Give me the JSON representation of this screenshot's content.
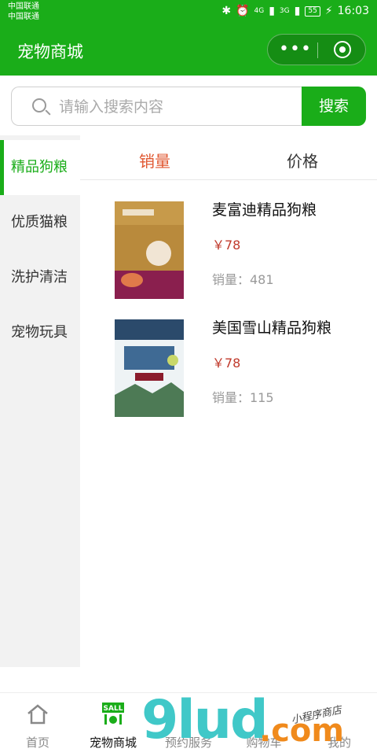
{
  "status_bar": {
    "carrier_1": "中国联通",
    "carrier_2": "中国联通",
    "signal_1": "4G",
    "signal_2": "3G",
    "battery": "55",
    "time": "16:03"
  },
  "nav": {
    "title": "宠物商城",
    "more": "•••"
  },
  "search": {
    "placeholder": "请输入搜索内容",
    "button": "搜索"
  },
  "sidebar": {
    "items": [
      {
        "label": "精品狗粮",
        "active": true
      },
      {
        "label": "优质猫粮",
        "active": false
      },
      {
        "label": "洗护清洁",
        "active": false
      },
      {
        "label": "宠物玩具",
        "active": false
      }
    ]
  },
  "sort_tabs": [
    {
      "label": "销量",
      "active": true
    },
    {
      "label": "价格",
      "active": false
    }
  ],
  "products": [
    {
      "name": "麦富迪精品狗粮",
      "price": "￥78",
      "sales": "销量：481",
      "image_icon": "dog-food-bag-icon"
    },
    {
      "name": "美国雪山精品狗粮",
      "price": "￥78",
      "sales": "销量：115",
      "image_icon": "dog-food-bag-icon"
    }
  ],
  "tab_bar": [
    {
      "label": "首页",
      "icon": "home-icon",
      "active": false
    },
    {
      "label": "宠物商城",
      "icon": "pet-shop-icon",
      "active": true,
      "badge": "SALL"
    },
    {
      "label": "预约服务",
      "icon": "calendar-icon",
      "active": false
    },
    {
      "label": "购物车",
      "icon": "cart-icon",
      "active": false
    },
    {
      "label": "我的",
      "icon": "user-icon",
      "active": false
    }
  ],
  "watermark": {
    "main": "9lud",
    "suffix": ".com",
    "small": "小程序商店"
  },
  "colors": {
    "brand_green": "#1aad19",
    "price_red": "#c0392b",
    "sort_active": "#e0562f"
  }
}
